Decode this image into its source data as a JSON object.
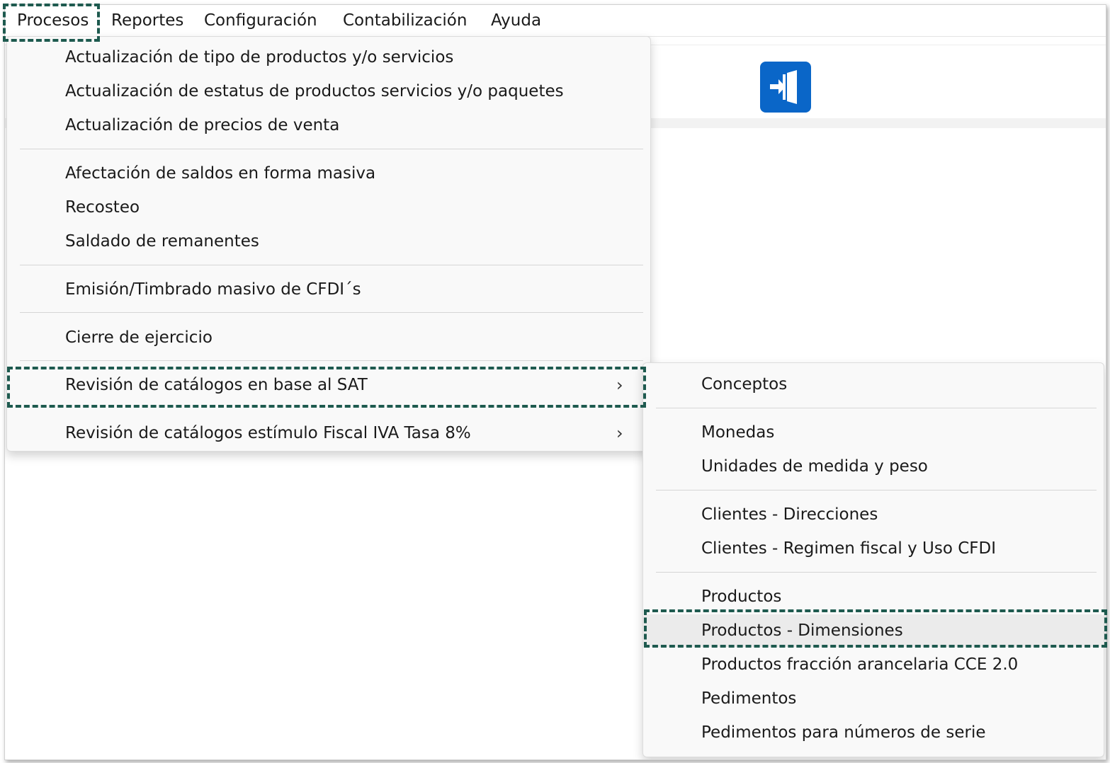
{
  "menubar": {
    "items": [
      "Procesos",
      "Reportes",
      "Configuración",
      "Contabilización",
      "Ayuda"
    ]
  },
  "toolbar": {
    "exit_icon": "exit-door-icon",
    "exit_color": "#0a66c8"
  },
  "procesos_menu": {
    "items": [
      "Actualización de tipo de productos y/o servicios",
      "Actualización de estatus de productos servicios y/o paquetes",
      "Actualización de precios de venta",
      "Afectación de saldos en forma masiva",
      "Recosteo",
      "Saldado de remanentes",
      "Emisión/Timbrado masivo de CFDI´s",
      "Cierre de ejercicio",
      "Revisión de catálogos en base al SAT",
      "Revisión de catálogos estímulo Fiscal IVA Tasa 8%"
    ]
  },
  "sat_submenu": {
    "items": [
      "Conceptos",
      "Monedas",
      "Unidades de medida y peso",
      "Clientes - Direcciones",
      "Clientes - Regimen fiscal y Uso CFDI",
      "Productos",
      "Productos - Dimensiones",
      "Productos fracción arancelaria CCE 2.0",
      "Pedimentos",
      "Pedimentos para números de serie"
    ]
  },
  "colors": {
    "highlight_border": "#1e5a4f"
  }
}
